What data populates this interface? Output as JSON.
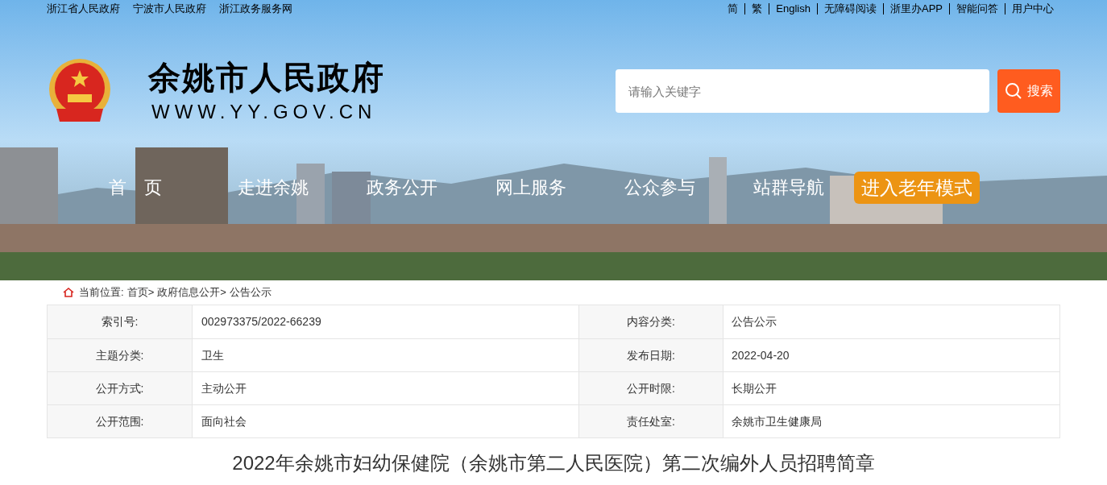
{
  "top_links_left": [
    "浙江省人民政府",
    "宁波市人民政府",
    "浙江政务服务网"
  ],
  "top_links_right": [
    "简",
    "繁",
    "English",
    "无障碍阅读",
    "浙里办APP",
    "智能问答",
    "用户中心"
  ],
  "site": {
    "title": "余姚市人民政府",
    "domain": "WWW.YY.GOV.CN"
  },
  "search": {
    "placeholder": "请输入关键字",
    "button": "搜索"
  },
  "nav": [
    {
      "label": "首　页",
      "kind": "link"
    },
    {
      "label": "走进余姚",
      "kind": "link"
    },
    {
      "label": "政务公开",
      "kind": "link"
    },
    {
      "label": "网上服务",
      "kind": "link"
    },
    {
      "label": "公众参与",
      "kind": "link"
    },
    {
      "label": "站群导航",
      "kind": "link"
    },
    {
      "label": "进入老年模式",
      "kind": "button"
    }
  ],
  "breadcrumb": {
    "label": "当前位置:",
    "separator": ">",
    "items": [
      "首页",
      "政府信息公开",
      "公告公示"
    ]
  },
  "info_table": [
    {
      "label_1": "索引号:",
      "value_1": "002973375/2022-66239",
      "label_2": "内容分类:",
      "value_2": "公告公示"
    },
    {
      "label_1": "主题分类:",
      "value_1": "卫生",
      "label_2": "发布日期:",
      "value_2": "2022-04-20"
    },
    {
      "label_1": "公开方式:",
      "value_1": "主动公开",
      "label_2": "公开时限:",
      "value_2": "长期公开"
    },
    {
      "label_1": "公开范围:",
      "value_1": "面向社会",
      "label_2": "责任处室:",
      "value_2": "余姚市卫生健康局"
    }
  ],
  "article_title": "2022年余姚市妇幼保健院（余姚市第二人民医院）第二次编外人员招聘简章"
}
